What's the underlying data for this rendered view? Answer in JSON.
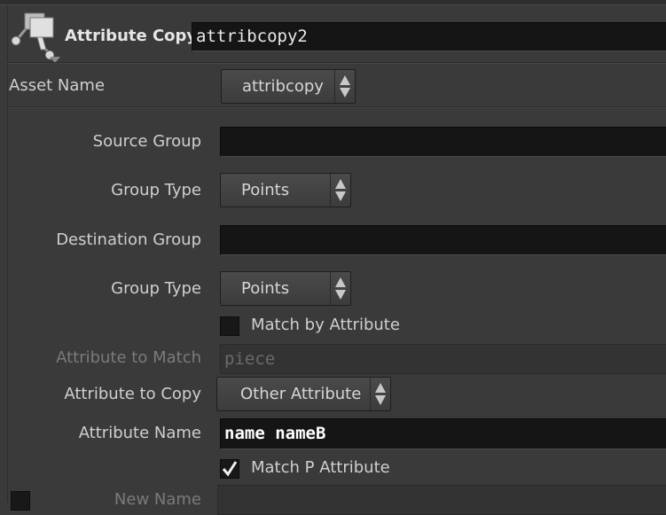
{
  "header": {
    "node_type": "Attribute Copy",
    "node_name": "attribcopy2",
    "node_icon": "attribute-copy-node-icon"
  },
  "asset": {
    "label": "Asset Name",
    "value": "attribcopy"
  },
  "params": {
    "source_group": {
      "label": "Source Group",
      "value": ""
    },
    "source_group_type": {
      "label": "Group Type",
      "value": "Points"
    },
    "destination_group": {
      "label": "Destination Group",
      "value": ""
    },
    "destination_group_type": {
      "label": "Group Type",
      "value": "Points"
    },
    "match_by_attribute": {
      "label": "Match by Attribute",
      "checked": false
    },
    "attribute_to_match": {
      "label": "Attribute to Match",
      "value": "piece",
      "disabled": true
    },
    "attribute_to_copy": {
      "label": "Attribute to Copy",
      "value": "Other Attribute"
    },
    "attribute_name": {
      "label": "Attribute Name",
      "value": "name nameB"
    },
    "match_p_attribute": {
      "label": "Match P Attribute",
      "checked": true
    },
    "new_name": {
      "label": "New Name",
      "value": ""
    }
  },
  "colors": {
    "background": "#3a3a3a",
    "field": "#151515",
    "text": "#cfcfcf",
    "disabled_text": "#7a7a7a"
  }
}
